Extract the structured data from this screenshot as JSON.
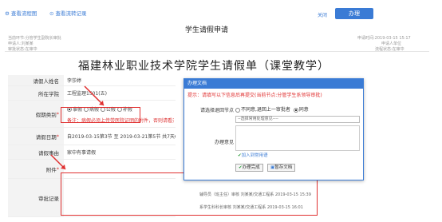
{
  "toolbar": {
    "view_flow": "查看流程图",
    "view_records": "查看流转记录",
    "close_label": "关闭",
    "submit_label": "办理"
  },
  "header": {
    "title": "学生请假申请",
    "meta_left_1": "当前环节:分管学生副院长审批",
    "meta_left_2": "申请人:刘某某",
    "meta_left_3": "审批状态:在审中",
    "meta_right_1": "申请时间:2019-03-15 15:17",
    "meta_right_2": "申请人单位",
    "meta_right_3": "流程状态:在审中"
  },
  "form": {
    "big_title": "福建林业职业技术学院学生请假单（课堂教学）",
    "name_label": "请假人姓名",
    "name_value": "李莎婷",
    "class_label": "所在学院",
    "class_value": "工程监理1501(五)",
    "type_label": "假期类别",
    "type_options": [
      "事假",
      "病假",
      "公假",
      "补假"
    ],
    "note_label": "备注",
    "note_value": "病假必须上传带医院证明的附件，否则请看无效",
    "date_label": "请假日期",
    "date_value": "自2019-03-15第3节 至 2019-03-21第5节 共7天6节",
    "reason_label": "请假事由",
    "reason_value": "家中有事请假",
    "attach_label": "附件",
    "log_label": "审批记录",
    "log_1": "辅导员（班主任）审核 刘某某/交通工程系 2019-03-15 15:39",
    "log_2": "系学生科科长审核 刘某某/交通工程系 2019-03-15 16:01"
  },
  "dialog": {
    "title": "办理文档",
    "tip": "提示：请填写以下信息后再提交(当前节点:分管学生系领导审批)",
    "node_label": "请选择退回节点",
    "option_no": "不同意,退回上一审批者",
    "option_yes": "同意",
    "select_placeholder": "--选择常用处理意见----",
    "opinion_label": "办理意见",
    "add_common": "加入到常用语",
    "submit_btn": "办理完成",
    "save_btn": "暂存文档"
  },
  "colors": {
    "accent": "#3a7bd5",
    "highlight": "#e03030"
  }
}
